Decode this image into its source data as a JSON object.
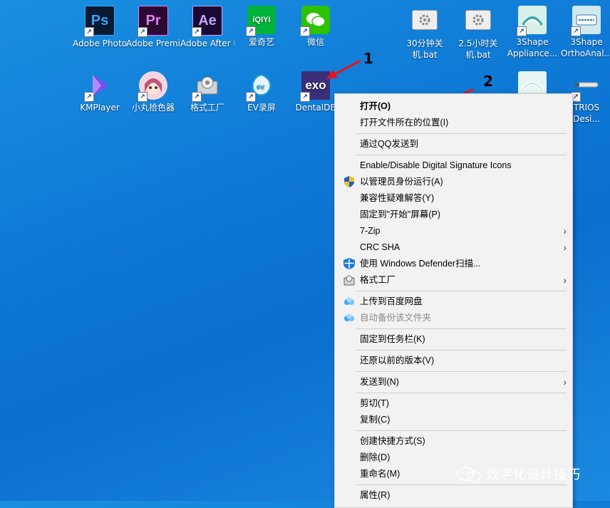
{
  "desktop_icons": [
    {
      "label": "Adobe Photosh...",
      "icon": "photoshop-icon",
      "abbr": "Ps",
      "bg": "#0a1a33",
      "fg": "#31a8ff"
    },
    {
      "label": "Adobe Premiere P...",
      "icon": "premiere-icon",
      "abbr": "Pr",
      "bg": "#2a0a33",
      "fg": "#e77cff"
    },
    {
      "label": "Adobe After Effects CC ...",
      "icon": "after-effects-icon",
      "abbr": "Ae",
      "bg": "#1a0a33",
      "fg": "#c9a2ff"
    },
    {
      "label": "爱奇艺",
      "icon": "iqiyi-icon",
      "abbr": "iQIYI",
      "bg": "#00b33c",
      "fg": "#ffffff"
    },
    {
      "label": "微信",
      "icon": "wechat-icon",
      "abbr": "",
      "bg": "#2dc100",
      "fg": "#ffffff"
    },
    {
      "label": "30分钟关机.bat",
      "icon": "bat-file-icon",
      "abbr": "",
      "bg": "#e8e8e8",
      "fg": "#666666"
    },
    {
      "label": "2.5小时关机.bat",
      "icon": "bat-file-icon",
      "abbr": "",
      "bg": "#e8e8e8",
      "fg": "#666666"
    },
    {
      "label": "3Shape Appliance...",
      "icon": "3shape-appliance-icon",
      "abbr": "",
      "bg": "#d8f0ea",
      "fg": "#3aa"
    },
    {
      "label": "3Shape OrthoAnal...",
      "icon": "3shape-ortho-icon",
      "abbr": "",
      "bg": "#d0e8f0",
      "fg": "#37a"
    },
    {
      "label": "KMPlayer",
      "icon": "kmplayer-icon",
      "abbr": "",
      "bg": "transparent",
      "fg": "#7b4ef0"
    },
    {
      "label": "小丸拾色器",
      "icon": "color-picker-icon",
      "abbr": "",
      "bg": "#f4d6e2",
      "fg": "#b05070"
    },
    {
      "label": "格式工厂",
      "icon": "format-factory-icon",
      "abbr": "",
      "bg": "#dfe3e6",
      "fg": "#555"
    },
    {
      "label": "EV录屏",
      "icon": "ev-recorder-icon",
      "abbr": "",
      "bg": "#e6f6ff",
      "fg": "#19a3d8"
    },
    {
      "label": "DentalDB",
      "icon": "dentaldb-icon",
      "abbr": "exo",
      "bg": "#3a2f78",
      "fg": "#ffffff"
    },
    {
      "label": "",
      "icon": "3shape-dental-icon",
      "abbr": "",
      "bg": "#e6f4f2",
      "fg": "#3aa"
    },
    {
      "label": "TRIOS Desi...",
      "icon": "trios-icon",
      "abbr": "",
      "bg": "transparent",
      "fg": "#ddd"
    }
  ],
  "context_menu": {
    "items": [
      {
        "label": "打开(O)",
        "bold": true
      },
      {
        "label": "打开文件所在的位置(I)"
      },
      {
        "label": "通过QQ发送到"
      },
      {
        "label": "Enable/Disable Digital Signature Icons"
      },
      {
        "label": "以管理员身份运行(A)",
        "icon": "uac-shield-icon"
      },
      {
        "label": "兼容性疑难解答(Y)"
      },
      {
        "label": "固定到\"开始\"屏幕(P)"
      },
      {
        "label": "7-Zip",
        "submenu": true
      },
      {
        "label": "CRC SHA",
        "submenu": true
      },
      {
        "label": "使用 Windows Defender扫描...",
        "icon": "defender-icon"
      },
      {
        "label": "格式工厂",
        "icon": "format-factory-icon",
        "submenu": true
      },
      {
        "label": "上传到百度网盘",
        "icon": "baidu-cloud-icon"
      },
      {
        "label": "自动备份该文件夹",
        "icon": "baidu-cloud-icon",
        "disabled": true
      },
      {
        "label": "固定到任务栏(K)"
      },
      {
        "label": "还原以前的版本(V)"
      },
      {
        "label": "发送到(N)",
        "submenu": true
      },
      {
        "label": "剪切(T)"
      },
      {
        "label": "复制(C)"
      },
      {
        "label": "创建快捷方式(S)"
      },
      {
        "label": "删除(D)"
      },
      {
        "label": "重命名(M)"
      },
      {
        "label": "属性(R)"
      }
    ],
    "submenu_arrow": "›"
  },
  "annotations": {
    "one": "1",
    "two": "2",
    "arrow_color": "#e8141c"
  },
  "watermark": {
    "text": "数字化设计技巧"
  }
}
